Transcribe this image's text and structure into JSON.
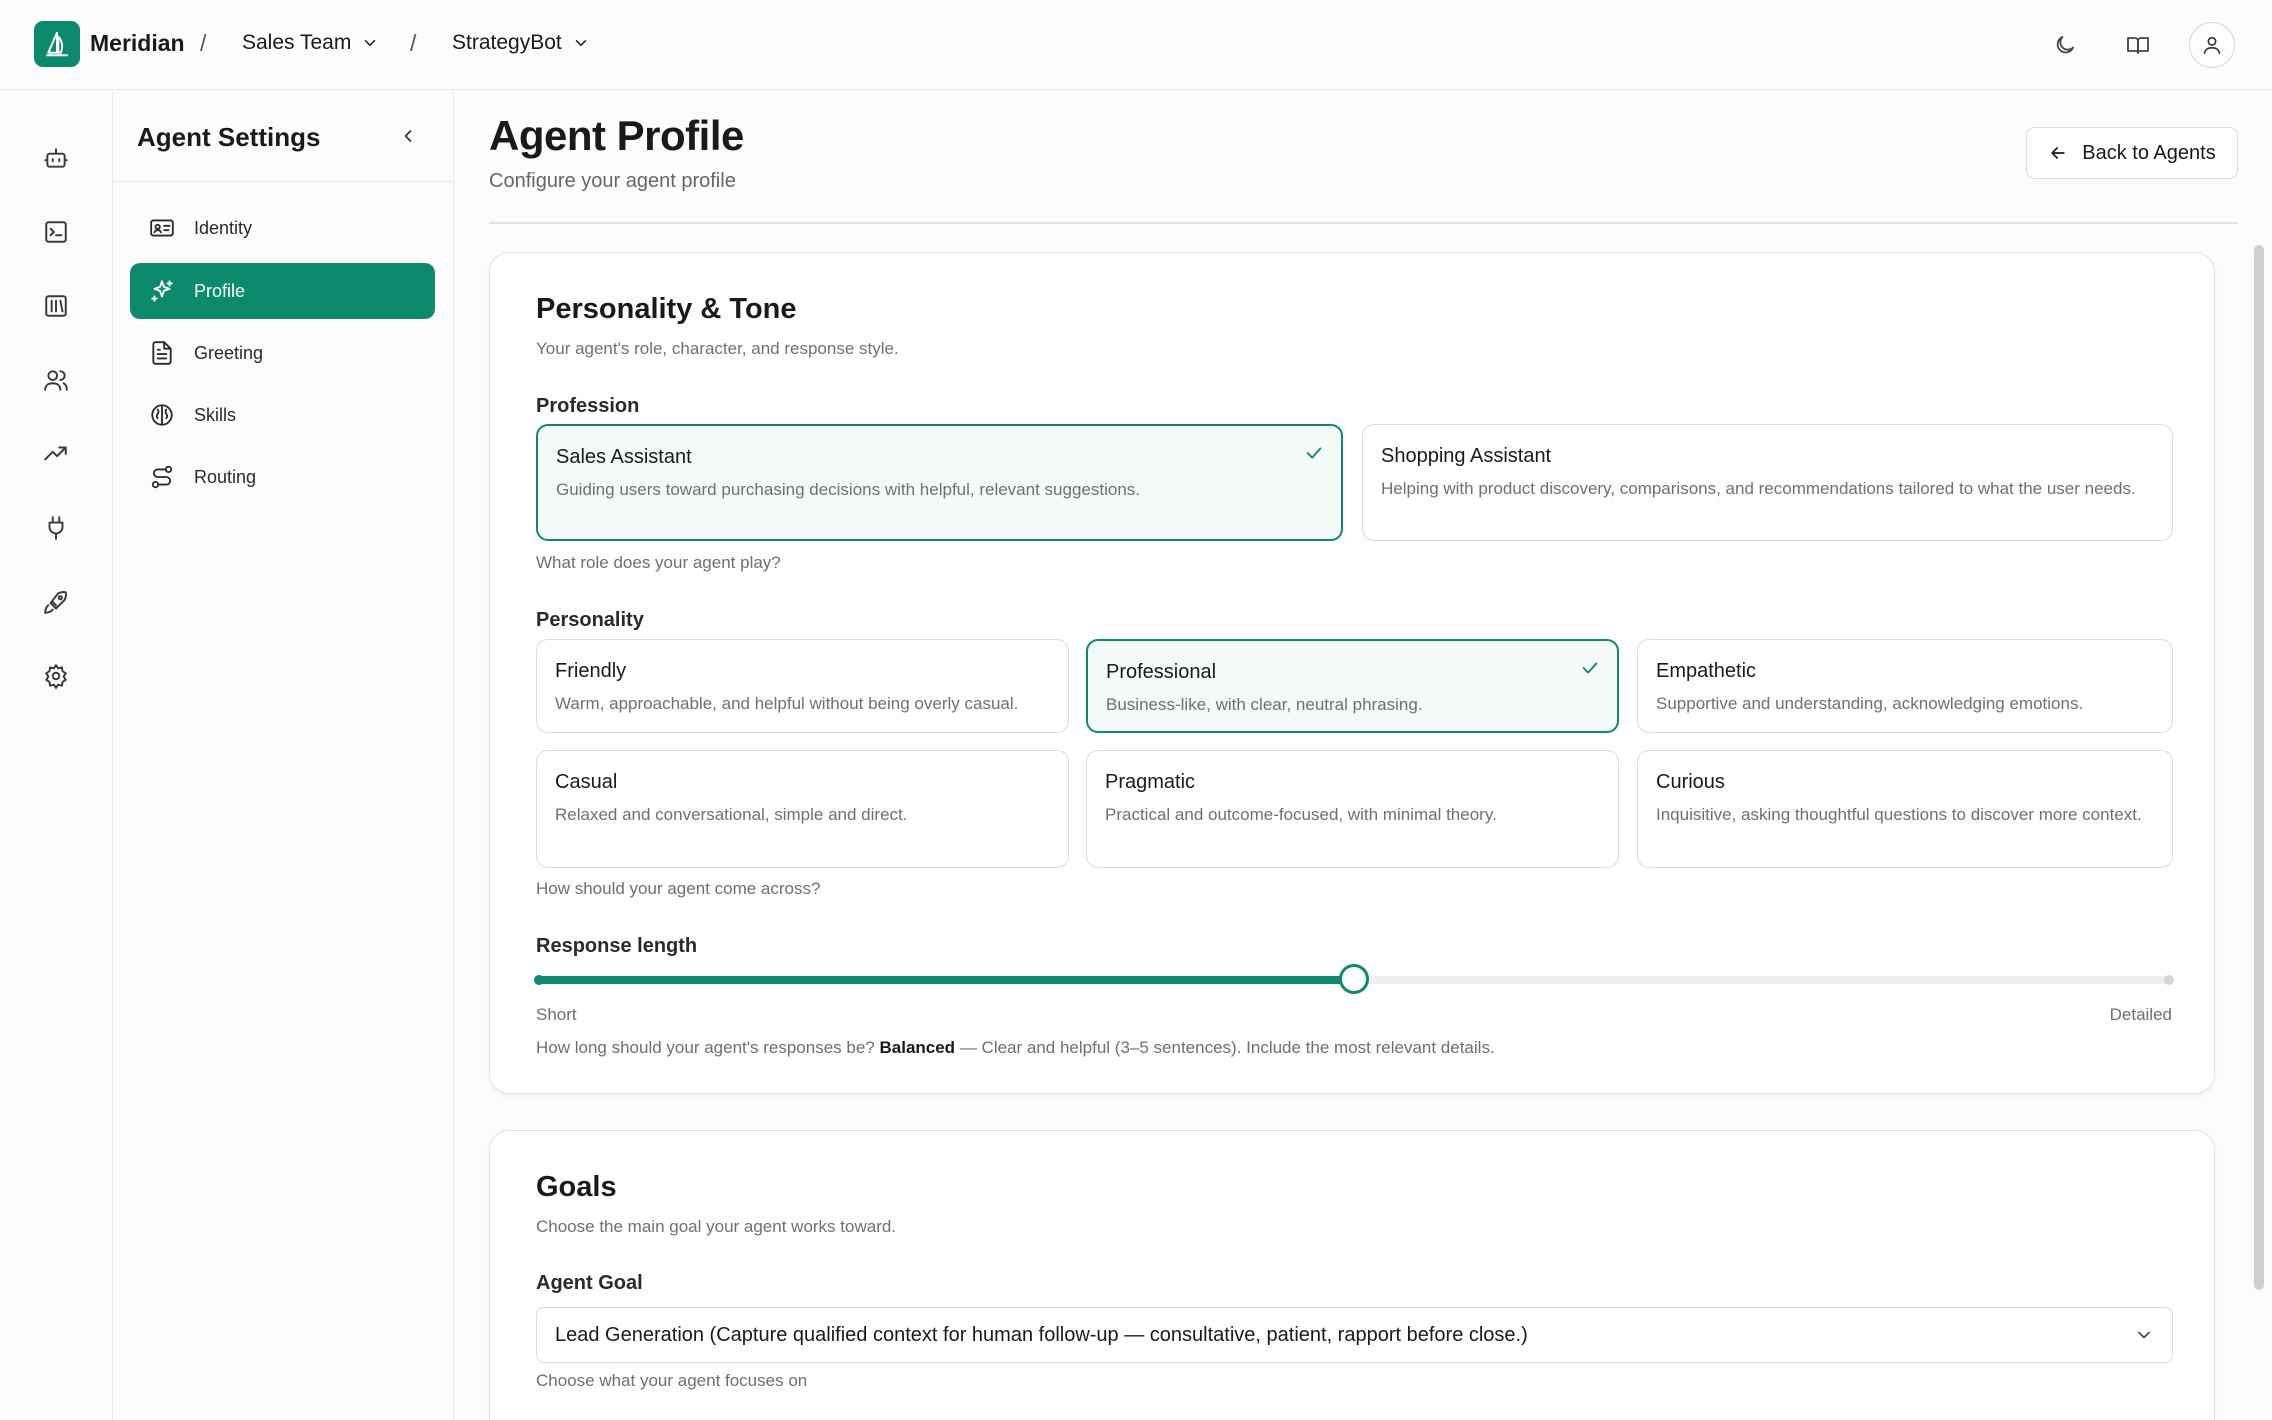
{
  "app": {
    "brand": "Meridian",
    "separator": "/"
  },
  "breadcrumbs": {
    "team": "Sales Team",
    "agent": "StrategyBot"
  },
  "rail": {
    "items": [
      "bot-icon",
      "terminal-icon",
      "library-icon",
      "users-icon",
      "trending-icon",
      "plug-icon",
      "rocket-icon",
      "settings-icon"
    ]
  },
  "sidebar": {
    "title": "Agent Settings",
    "items": [
      {
        "label": "Identity",
        "icon": "id-card-icon"
      },
      {
        "label": "Profile",
        "icon": "sparkles-icon"
      },
      {
        "label": "Greeting",
        "icon": "document-icon"
      },
      {
        "label": "Skills",
        "icon": "brain-icon"
      },
      {
        "label": "Routing",
        "icon": "route-icon"
      }
    ],
    "active": "Profile"
  },
  "header": {
    "title": "Agent Profile",
    "subtitle": "Configure your agent profile",
    "back_label": "Back to Agents"
  },
  "personality_card": {
    "title": "Personality & Tone",
    "description": "Your agent's role, character, and response style.",
    "profession": {
      "label": "Profession",
      "help": "What role does your agent play?",
      "options": [
        {
          "title": "Sales Assistant",
          "desc": "Guiding users toward purchasing decisions with helpful, relevant suggestions.",
          "selected": true
        },
        {
          "title": "Shopping Assistant",
          "desc": "Helping with product discovery, comparisons, and recommendations tailored to what the user needs.",
          "selected": false
        }
      ]
    },
    "personality": {
      "label": "Personality",
      "help": "How should your agent come across?",
      "options": [
        {
          "title": "Friendly",
          "desc": "Warm, approachable, and helpful without being overly casual.",
          "selected": false
        },
        {
          "title": "Professional",
          "desc": "Business-like, with clear, neutral phrasing.",
          "selected": true
        },
        {
          "title": "Empathetic",
          "desc": "Supportive and understanding, acknowledging emotions.",
          "selected": false
        },
        {
          "title": "Casual",
          "desc": "Relaxed and conversational, simple and direct.",
          "selected": false
        },
        {
          "title": "Pragmatic",
          "desc": "Practical and outcome-focused, with minimal theory.",
          "selected": false
        },
        {
          "title": "Curious",
          "desc": "Inquisitive, asking thoughtful questions to discover more context.",
          "selected": false
        }
      ]
    },
    "response_length": {
      "label": "Response length",
      "min_label": "Short",
      "max_label": "Detailed",
      "value_fraction": 0.5,
      "help_prefix": "How long should your agent's responses be?",
      "value_name": "Balanced",
      "value_desc": "— Clear and helpful (3–5 sentences). Include the most relevant details."
    }
  },
  "goals_card": {
    "title": "Goals",
    "description": "Choose the main goal your agent works toward.",
    "goal_label": "Agent Goal",
    "goal_value": "Lead Generation (Capture qualified context for human follow-up — consultative, patient, rapport before close.)",
    "goal_help": "Choose what your agent focuses on"
  },
  "colors": {
    "accent": "#0c8a6e",
    "border": "#dcdcda",
    "muted_text": "#707070"
  }
}
